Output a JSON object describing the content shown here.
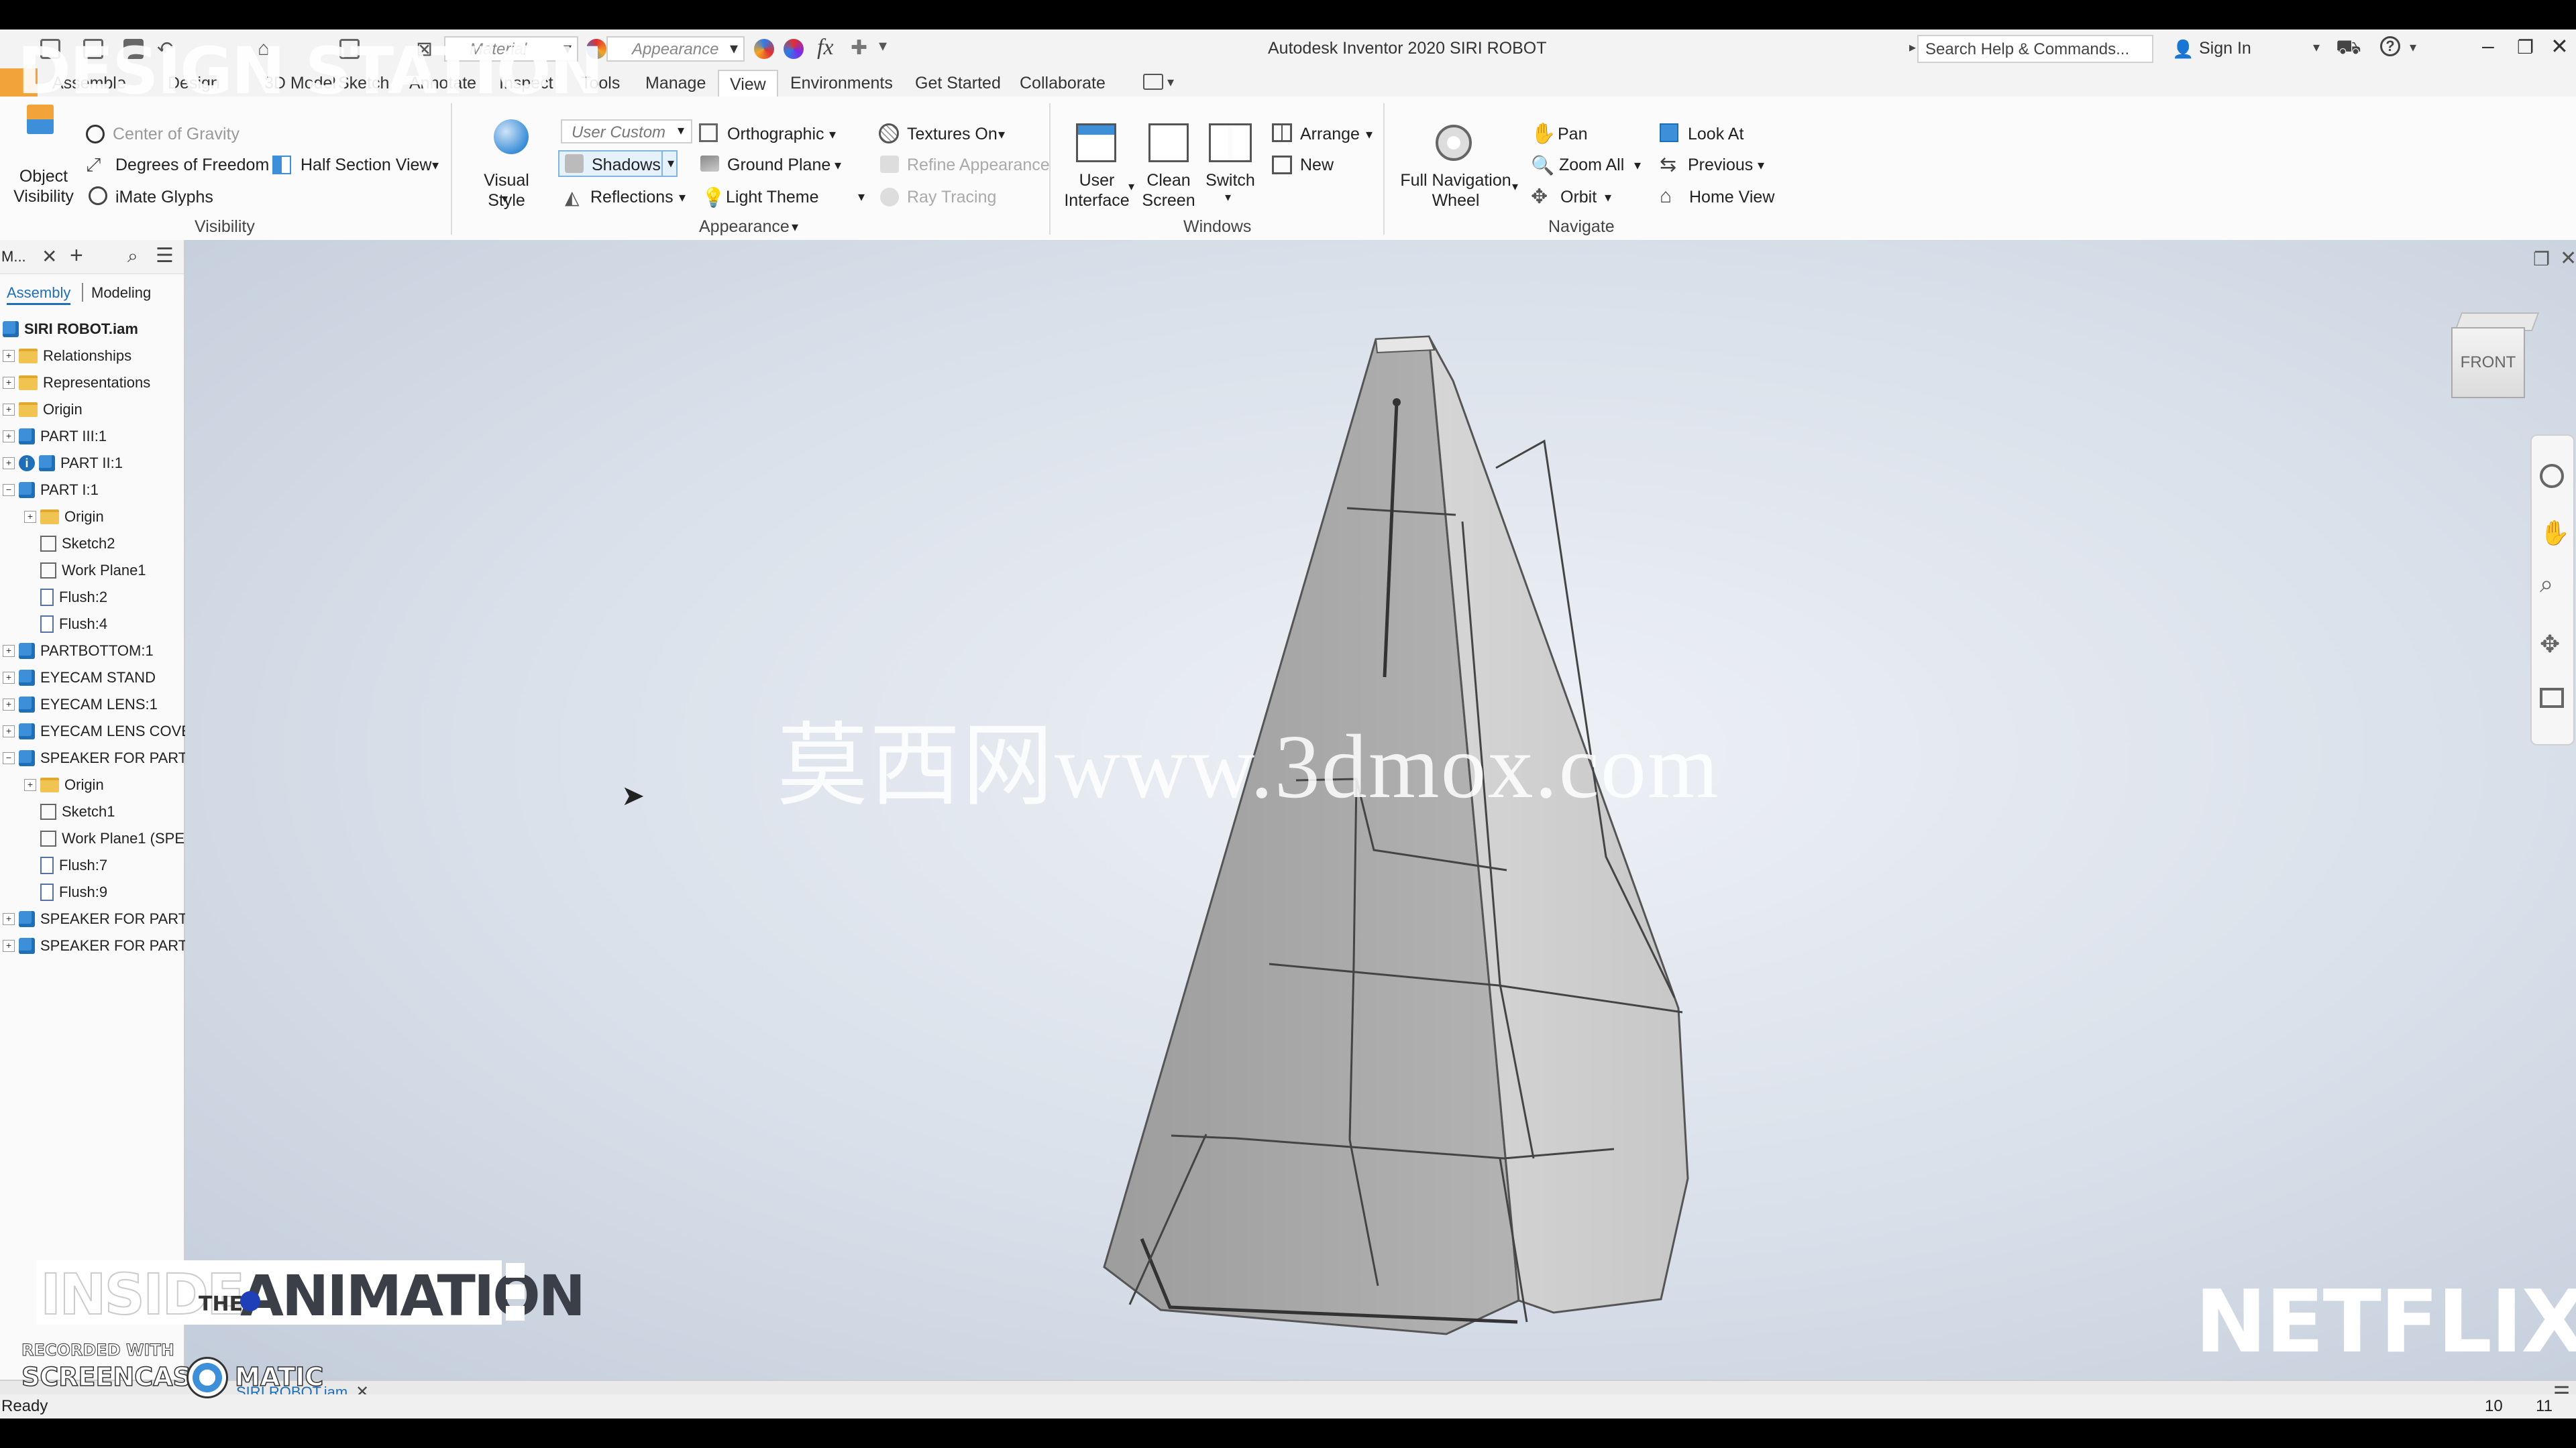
{
  "window": {
    "title": "Autodesk Inventor 2020   SIRI ROBOT"
  },
  "quick_access": {
    "material_dd": "Material",
    "appearance_dd": "Appearance",
    "fx_label": "fx"
  },
  "help": {
    "search_placeholder": "Search Help & Commands...",
    "sign_in": "Sign In",
    "help_q": "?"
  },
  "tabs": [
    "Assemble",
    "Design",
    "3D Model",
    "Sketch",
    "Annotate",
    "Inspect",
    "Tools",
    "Manage",
    "View",
    "Environments",
    "Get Started",
    "Collaborate"
  ],
  "active_tab": "View",
  "ribbon": {
    "visibility": {
      "object_visibility": "Object Visibility",
      "center_of_gravity": "Center of Gravity",
      "degrees_of_freedom": "Degrees of Freedom",
      "imate_glyphs": "iMate Glyphs",
      "half_section": "Half Section View",
      "panel": "Visibility"
    },
    "appearance": {
      "visual_style": "Visual Style",
      "user_custom": "User Custom",
      "shadows": "Shadows",
      "reflections": "Reflections",
      "orthographic": "Orthographic",
      "ground_plane": "Ground Plane",
      "light_theme": "Light Theme",
      "textures_on": "Textures On",
      "refine_appearance": "Refine Appearance",
      "ray_tracing": "Ray Tracing",
      "panel": "Appearance"
    },
    "windows": {
      "user_interface": "User Interface",
      "clean_screen": "Clean Screen",
      "switch": "Switch",
      "arrange": "Arrange",
      "new": "New",
      "panel": "Windows"
    },
    "navigate": {
      "full_nav_wheel": "Full Navigation Wheel",
      "pan": "Pan",
      "zoom_all": "Zoom All",
      "orbit": "Orbit",
      "look_at": "Look At",
      "previous": "Previous",
      "home_view": "Home View",
      "panel": "Navigate"
    }
  },
  "browser": {
    "title": "M...",
    "tab_assembly": "Assembly",
    "tab_modeling": "Modeling",
    "tree": [
      {
        "label": "SIRI ROBOT.iam",
        "icon": "assembly",
        "level": 0,
        "exp": ""
      },
      {
        "label": "Relationships",
        "icon": "folder",
        "level": 1,
        "exp": "+"
      },
      {
        "label": "Representations",
        "icon": "folder",
        "level": 1,
        "exp": "+"
      },
      {
        "label": "Origin",
        "icon": "folder",
        "level": 1,
        "exp": "+"
      },
      {
        "label": "PART III:1",
        "icon": "part",
        "level": 1,
        "exp": "+"
      },
      {
        "label": "PART II:1",
        "icon": "part-info",
        "level": 1,
        "exp": "+"
      },
      {
        "label": "PART I:1",
        "icon": "part",
        "level": 1,
        "exp": "−"
      },
      {
        "label": "Origin",
        "icon": "folder",
        "level": 2,
        "exp": "+"
      },
      {
        "label": "Sketch2",
        "icon": "sketch",
        "level": 2,
        "exp": ""
      },
      {
        "label": "Work Plane1",
        "icon": "sketch",
        "level": 2,
        "exp": ""
      },
      {
        "label": "Flush:2",
        "icon": "flush",
        "level": 2,
        "exp": ""
      },
      {
        "label": "Flush:4",
        "icon": "flush",
        "level": 2,
        "exp": ""
      },
      {
        "label": "PARTBOTTOM:1",
        "icon": "part",
        "level": 1,
        "exp": "+"
      },
      {
        "label": "EYECAM STAND",
        "icon": "part",
        "level": 1,
        "exp": "+"
      },
      {
        "label": "EYECAM LENS:1",
        "icon": "part",
        "level": 1,
        "exp": "+"
      },
      {
        "label": "EYECAM LENS COVER",
        "icon": "part",
        "level": 1,
        "exp": "+"
      },
      {
        "label": "SPEAKER FOR PARTI",
        "icon": "part",
        "level": 1,
        "exp": "−"
      },
      {
        "label": "Origin",
        "icon": "folder",
        "level": 2,
        "exp": "+"
      },
      {
        "label": "Sketch1",
        "icon": "sketch",
        "level": 2,
        "exp": ""
      },
      {
        "label": "Work Plane1 (SPE",
        "icon": "sketch",
        "level": 2,
        "exp": ""
      },
      {
        "label": "Flush:7",
        "icon": "flush",
        "level": 2,
        "exp": ""
      },
      {
        "label": "Flush:9",
        "icon": "flush",
        "level": 2,
        "exp": ""
      },
      {
        "label": "SPEAKER FOR PART I",
        "icon": "part",
        "level": 1,
        "exp": "+"
      },
      {
        "label": "SPEAKER FOR PART I",
        "icon": "part",
        "level": 1,
        "exp": "+"
      }
    ]
  },
  "viewcube": {
    "face": "FRONT"
  },
  "overlays": {
    "design_station": "DESIGN STATION",
    "watermark_cn": "莫西网www.3dmox.com",
    "inside": "INSIDE",
    "the": "THE",
    "animation": "ANIMATION",
    "netflix": "NETFLIX",
    "recorded_with": "RECORDED WITH",
    "screencast": "SCREENCAST",
    "matic": "MATIC"
  },
  "doc_tab": "SIRI ROBOT.iam",
  "status": {
    "text": "Ready",
    "num1": "10",
    "num2": "11"
  },
  "colors": {
    "accent": "#1f6fb8",
    "part_blue": "#3c8fd8",
    "model_gray": "#a9a9a9"
  }
}
